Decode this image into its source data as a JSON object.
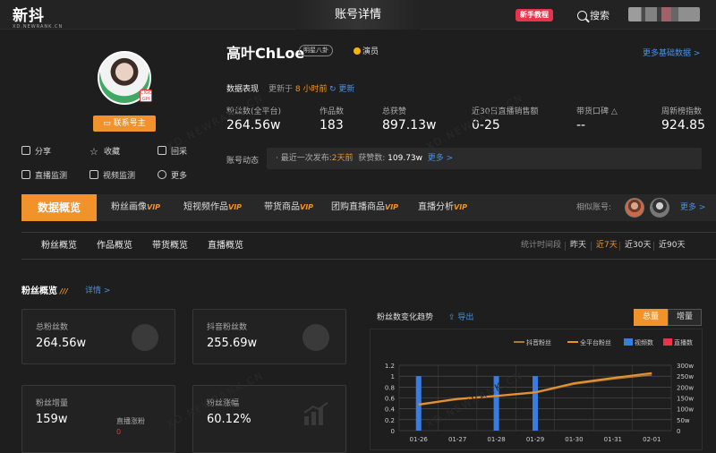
{
  "topbar": {
    "logo": "新抖",
    "logo_sub": "XD.NEWRANK.CN",
    "title": "账号详情",
    "tutorial": "新手教程",
    "search": "搜索"
  },
  "profile": {
    "name": "高叶ChLoe",
    "tag": "明星八卦",
    "role": "演员",
    "avatar_badge": "CIGO GPI",
    "contact_button": "联系号主",
    "actions": [
      "分享",
      "收藏",
      "回采",
      "直播监测",
      "视频监测",
      "更多"
    ],
    "more_basic": "更多基础数据 >"
  },
  "performance": {
    "label": "数据表现",
    "update_prefix": "更新于",
    "update_time": "8 小时前",
    "refresh": "更新",
    "stats": [
      {
        "label": "粉丝数(全平台)",
        "value": "264.56w"
      },
      {
        "label": "作品数",
        "value": "183"
      },
      {
        "label": "总获赞",
        "value": "897.13w"
      },
      {
        "label": "近30日直播销售额",
        "value": "0-25"
      },
      {
        "label": "带货口碑",
        "value": "--"
      },
      {
        "label": "周新榜指数",
        "value": "924.85"
      }
    ]
  },
  "dynamics": {
    "label": "账号动态",
    "prefix": "· 最近一次发布:",
    "time": "2天前",
    "likes_label": "获赞数:",
    "likes": "109.73w",
    "more": "更多 >"
  },
  "nav": {
    "active": "数据概览",
    "items": [
      {
        "label": "粉丝画像",
        "vip": "VIP"
      },
      {
        "label": "短视频作品",
        "vip": "VIP"
      },
      {
        "label": "带货商品",
        "vip": "VIP"
      },
      {
        "label": "团购直播商品",
        "vip": "VIP"
      },
      {
        "label": "直播分析",
        "vip": "VIP"
      }
    ],
    "similar": "相似账号:",
    "more": "更多 >"
  },
  "subnav": {
    "items": [
      "粉丝概览",
      "作品概览",
      "带货概览",
      "直播概览"
    ],
    "period_label": "统计时间段",
    "periods": [
      "昨天",
      "近7天",
      "近30天",
      "近90天"
    ],
    "selected_period": "近7天"
  },
  "fans": {
    "title": "粉丝概览",
    "marks": "///",
    "detail": "详情 >",
    "cards": [
      {
        "label": "总粉丝数",
        "value": "264.56w"
      },
      {
        "label": "抖音粉丝数",
        "value": "255.69w"
      },
      {
        "label": "粉丝增量",
        "value": "159w",
        "sub_label": "直播涨粉",
        "sub_value": "0"
      },
      {
        "label": "粉丝涨幅",
        "value": "60.12%"
      }
    ],
    "trend_title": "粉丝数变化趋势",
    "export": "导出",
    "toggle_on": "总量",
    "toggle_off": "增量"
  },
  "colors": {
    "accent": "#f2922b",
    "link": "#4a90e2",
    "video_bar": "#3a7de0",
    "live_bar": "#e8344a"
  },
  "chart_data": {
    "type": "line",
    "categories": [
      "01-26",
      "01-27",
      "01-28",
      "01-29",
      "01-30",
      "01-31",
      "02-01"
    ],
    "left_axis": {
      "ticks": [
        "0",
        "0.2",
        "0.4",
        "0.6",
        "0.8",
        "1",
        "1.2"
      ],
      "ylim": [
        0,
        1.2
      ]
    },
    "right_axis": {
      "ticks": [
        "0",
        "50w",
        "100w",
        "150w",
        "200w",
        "250w",
        "300w"
      ],
      "ylim": [
        0,
        300
      ]
    },
    "series": [
      {
        "name": "抖音粉丝",
        "axis": "right",
        "values": [
          117,
          143,
          157,
          173,
          213,
          237,
          256
        ]
      },
      {
        "name": "全平台粉丝",
        "axis": "right",
        "values": [
          120,
          146,
          160,
          176,
          218,
          242,
          264
        ]
      },
      {
        "name": "视频数",
        "axis": "left",
        "kind": "bar",
        "values": [
          1,
          0,
          1,
          1,
          0,
          0,
          0
        ]
      },
      {
        "name": "直播数",
        "axis": "left",
        "kind": "bar",
        "values": [
          0,
          0,
          0,
          0,
          0,
          0,
          0
        ]
      }
    ],
    "grid": true,
    "legend": "top-right"
  }
}
